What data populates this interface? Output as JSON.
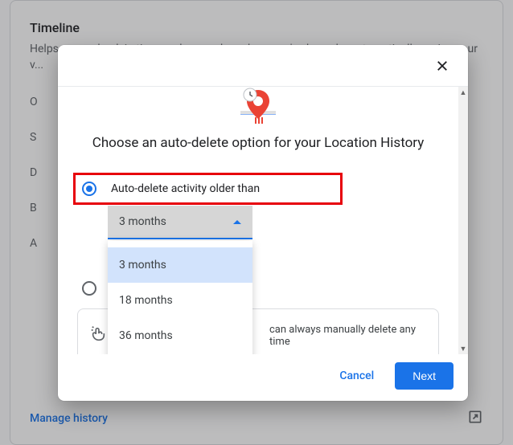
{
  "background": {
    "title": "Timeline",
    "description": "Helps you go back in time, and remember where you've been, by automatically saving your v...",
    "letters": [
      "O",
      "S",
      "D",
      "B",
      "A"
    ],
    "manage_link": "Manage history"
  },
  "modal": {
    "title": "Choose an auto-delete option for your Location History",
    "option1_label": "Auto-delete activity older than",
    "dropdown_selected": "3 months",
    "dropdown_options": [
      "3 months",
      "18 months",
      "36 months"
    ],
    "info_text_partial": "can always manually delete any time",
    "cancel_label": "Cancel",
    "next_label": "Next"
  }
}
